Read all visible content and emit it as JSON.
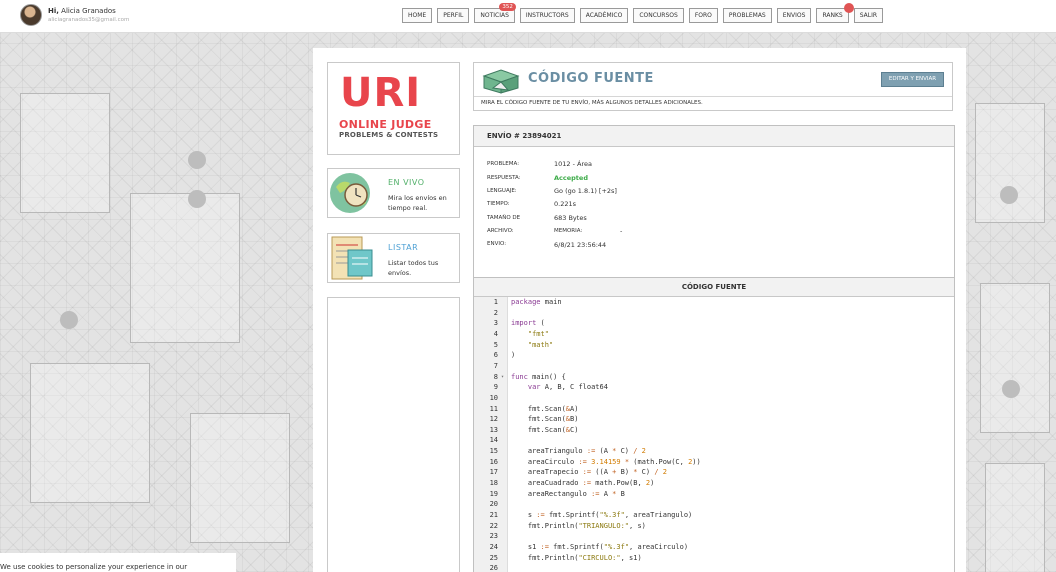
{
  "user": {
    "greeting_prefix": "Hi,",
    "name": "Alicia Granados",
    "email": "aliciagranados35@gmail.com"
  },
  "nav": {
    "items": [
      "HOME",
      "PERFIL",
      "NOTICIAS",
      "INSTRUCTORS",
      "ACADÉMICO",
      "CONCURSOS",
      "FORO",
      "PROBLEMAS",
      "ENVIOS",
      "RANKS",
      "SALIR"
    ],
    "noticias_badge": "352",
    "badge_color": "#e05454"
  },
  "logo": {
    "line1": "URI",
    "line2": "ONLINE JUDGE",
    "line3": "PROBLEMS & CONTESTS"
  },
  "live": {
    "title": "EN VIVO",
    "description": "Mira los envíos en tiempo real."
  },
  "list": {
    "title": "LISTAR",
    "description": "Listar todos tus envíos."
  },
  "source_header": {
    "title": "CÓDIGO FUENTE",
    "subtitle": "MIRA EL CÓDIGO FUENTE DE TU ENVÍO, MÁS ALGUNOS DETALLES ADICIONALES.",
    "edit_button": "EDITAR Y ENVIAR"
  },
  "submission": {
    "header": "ENVÍO # 23894021",
    "labels": {
      "problem": "PROBLEMA:",
      "answer": "RESPUESTA:",
      "language": "LENGUAJE:",
      "time": "TIEMPO:",
      "size": "TAMAÑO DE",
      "file": "ARCHIVO:",
      "memory": "MEMORIA:",
      "sent": "ENVIO:"
    },
    "values": {
      "problem": "1012 - Área",
      "answer": "Accepted",
      "language": "Go (go 1.8.1) [+2s]",
      "time": "0.221s",
      "size": "683 Bytes",
      "memory": "-",
      "sent": "6/8/21 23:56:44"
    }
  },
  "code_panel": {
    "header": "CÓDIGO FUENTE",
    "lines": [
      {
        "n": "1",
        "t": "package main"
      },
      {
        "n": "2",
        "t": ""
      },
      {
        "n": "3",
        "t": "import ("
      },
      {
        "n": "4",
        "t": "    \"fmt\""
      },
      {
        "n": "5",
        "t": "    \"math\""
      },
      {
        "n": "6",
        "t": ")"
      },
      {
        "n": "7",
        "t": ""
      },
      {
        "n": "8",
        "t": "func main() {"
      },
      {
        "n": "9",
        "t": "    var A, B, C float64"
      },
      {
        "n": "10",
        "t": ""
      },
      {
        "n": "11",
        "t": "    fmt.Scan(&A)"
      },
      {
        "n": "12",
        "t": "    fmt.Scan(&B)"
      },
      {
        "n": "13",
        "t": "    fmt.Scan(&C)"
      },
      {
        "n": "14",
        "t": ""
      },
      {
        "n": "15",
        "t": "    areaTriangulo := (A * C) / 2"
      },
      {
        "n": "16",
        "t": "    areaCirculo := 3.14159 * (math.Pow(C, 2))"
      },
      {
        "n": "17",
        "t": "    areaTrapecio := ((A + B) * C) / 2"
      },
      {
        "n": "18",
        "t": "    areaCuadrado := math.Pow(B, 2)"
      },
      {
        "n": "19",
        "t": "    areaRectangulo := A * B"
      },
      {
        "n": "20",
        "t": ""
      },
      {
        "n": "21",
        "t": "    s := fmt.Sprintf(\"%.3f\", areaTriangulo)"
      },
      {
        "n": "22",
        "t": "    fmt.Println(\"TRIANGULO:\", s)"
      },
      {
        "n": "23",
        "t": ""
      },
      {
        "n": "24",
        "t": "    s1 := fmt.Sprintf(\"%.3f\", areaCirculo)"
      },
      {
        "n": "25",
        "t": "    fmt.Println(\"CIRCULO:\", s1)"
      },
      {
        "n": "26",
        "t": ""
      }
    ]
  },
  "cookie_notice": "We use cookies to personalize your experience in our"
}
